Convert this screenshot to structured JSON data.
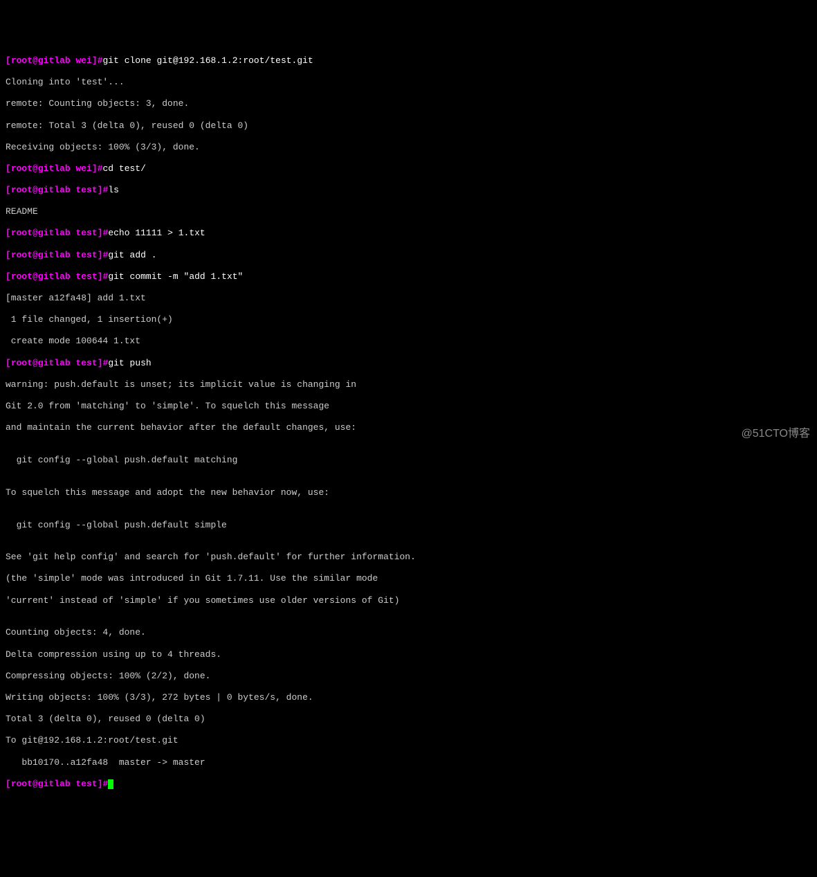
{
  "prompts": {
    "p0": {
      "bracket_open": "[",
      "user": "root",
      "at": "@",
      "host": "gitlab",
      "space": " ",
      "path": "wei",
      "bracket_close": "]",
      "hash": "#"
    },
    "p1": {
      "bracket_open": "[",
      "user": "root",
      "at": "@",
      "host": "gitlab",
      "space": " ",
      "path": "wei",
      "bracket_close": "]",
      "hash": "#"
    },
    "p2": {
      "bracket_open": "[",
      "user": "root",
      "at": "@",
      "host": "gitlab",
      "space": " ",
      "path": "test",
      "bracket_close": "]",
      "hash": "#"
    },
    "p3": {
      "bracket_open": "[",
      "user": "root",
      "at": "@",
      "host": "gitlab",
      "space": " ",
      "path": "test",
      "bracket_close": "]",
      "hash": "#"
    },
    "p4": {
      "bracket_open": "[",
      "user": "root",
      "at": "@",
      "host": "gitlab",
      "space": " ",
      "path": "test",
      "bracket_close": "]",
      "hash": "#"
    },
    "p5": {
      "bracket_open": "[",
      "user": "root",
      "at": "@",
      "host": "gitlab",
      "space": " ",
      "path": "test",
      "bracket_close": "]",
      "hash": "#"
    },
    "p6": {
      "bracket_open": "[",
      "user": "root",
      "at": "@",
      "host": "gitlab",
      "space": " ",
      "path": "test",
      "bracket_close": "]",
      "hash": "#"
    },
    "p7": {
      "bracket_open": "[",
      "user": "root",
      "at": "@",
      "host": "gitlab",
      "space": " ",
      "path": "test",
      "bracket_close": "]",
      "hash": "#"
    }
  },
  "commands": {
    "c0": "git clone git@192.168.1.2:root/test.git",
    "c1": "cd test/",
    "c2": "ls",
    "c3": "echo 11111 > 1.txt",
    "c4": "git add .",
    "c5": "git commit -m \"add 1.txt\"",
    "c6": "git push",
    "c7": ""
  },
  "outputs": {
    "o0": "Cloning into 'test'...",
    "o1": "remote: Counting objects: 3, done.",
    "o2": "remote: Total 3 (delta 0), reused 0 (delta 0)",
    "o3": "Receiving objects: 100% (3/3), done.",
    "o4": "README",
    "o5": "[master a12fa48] add 1.txt",
    "o6": " 1 file changed, 1 insertion(+)",
    "o7": " create mode 100644 1.txt",
    "o8": "warning: push.default is unset; its implicit value is changing in",
    "o9": "Git 2.0 from 'matching' to 'simple'. To squelch this message",
    "o10": "and maintain the current behavior after the default changes, use:",
    "o11": "",
    "o12": "  git config --global push.default matching",
    "o13": "",
    "o14": "To squelch this message and adopt the new behavior now, use:",
    "o15": "",
    "o16": "  git config --global push.default simple",
    "o17": "",
    "o18": "See 'git help config' and search for 'push.default' for further information.",
    "o19": "(the 'simple' mode was introduced in Git 1.7.11. Use the similar mode",
    "o20": "'current' instead of 'simple' if you sometimes use older versions of Git)",
    "o21": "",
    "o22": "Counting objects: 4, done.",
    "o23": "Delta compression using up to 4 threads.",
    "o24": "Compressing objects: 100% (2/2), done.",
    "o25": "Writing objects: 100% (3/3), 272 bytes | 0 bytes/s, done.",
    "o26": "Total 3 (delta 0), reused 0 (delta 0)",
    "o27": "To git@192.168.1.2:root/test.git",
    "o28": "   bb10170..a12fa48  master -> master"
  },
  "watermark": "@51CTO博客"
}
